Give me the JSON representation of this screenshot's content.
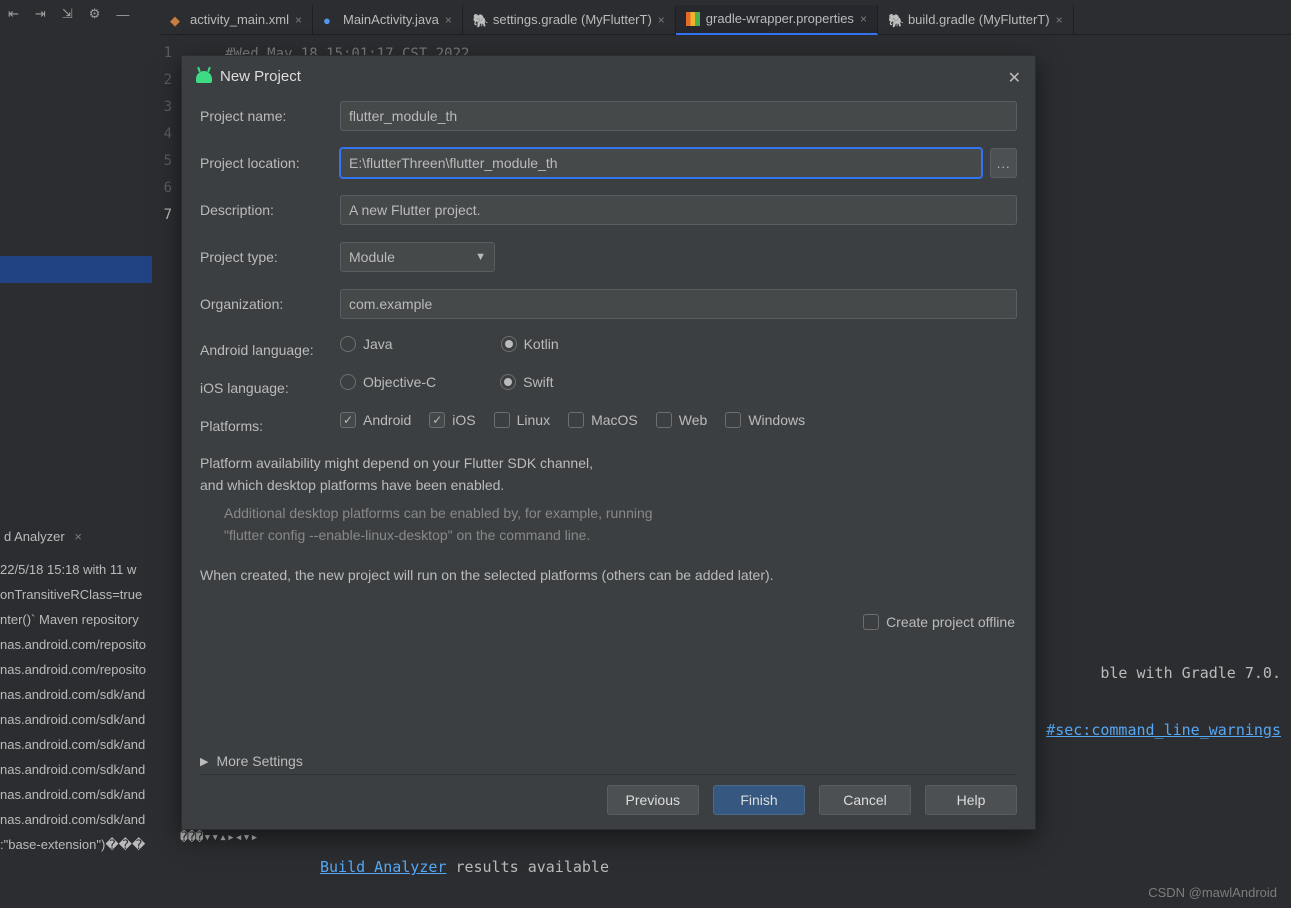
{
  "toolbar_icons": [
    "⇤",
    "⇥",
    "⇲",
    "⚙",
    "—"
  ],
  "tabs": [
    {
      "label": "activity_main.xml",
      "icon": "xml"
    },
    {
      "label": "MainActivity.java",
      "icon": "java"
    },
    {
      "label": "settings.gradle (MyFlutterT)",
      "icon": "gradle"
    },
    {
      "label": "gradle-wrapper.properties",
      "icon": "prop",
      "active": true
    },
    {
      "label": "build.gradle (MyFlutterT)",
      "icon": "gradle"
    }
  ],
  "gutter": [
    "1",
    "2",
    "3",
    "4",
    "5",
    "6",
    "7"
  ],
  "gutter_current": "7",
  "code_fragment": "#Wed May 18 15:01:17 CST 2022",
  "bottom": {
    "title": "d Analyzer",
    "lines": [
      "22/5/18 15:18 with 11 w",
      "onTransitiveRClass=true",
      "nter()` Maven repository",
      "nas.android.com/reposito",
      "nas.android.com/reposito",
      "nas.android.com/sdk/and",
      "nas.android.com/sdk/and",
      "nas.android.com/sdk/and",
      "nas.android.com/sdk/and",
      "nas.android.com/sdk/and",
      "nas.android.com/sdk/and",
      ":\"base-extension\")���"
    ]
  },
  "editor_out": {
    "line1": "ble with Gradle 7.0.",
    "link": "#sec:command_line_warnings",
    "build_link": "Build Analyzer",
    "build_rest": " results available"
  },
  "dialog": {
    "title": "New Project",
    "labels": {
      "name": "Project name:",
      "location": "Project location:",
      "desc": "Description:",
      "type": "Project type:",
      "org": "Organization:",
      "android_lang": "Android language:",
      "ios_lang": "iOS language:",
      "platforms": "Platforms:"
    },
    "values": {
      "name": "flutter_module_th",
      "location": "E:\\flutterThreen\\flutter_module_th",
      "desc": "A new Flutter project.",
      "type": "Module",
      "org": "com.example"
    },
    "android_lang": {
      "java": "Java",
      "kotlin": "Kotlin",
      "selected": "kotlin"
    },
    "ios_lang": {
      "objc": "Objective-C",
      "swift": "Swift",
      "selected": "swift"
    },
    "platforms": [
      {
        "name": "Android",
        "checked": true
      },
      {
        "name": "iOS",
        "checked": true
      },
      {
        "name": "Linux",
        "checked": false
      },
      {
        "name": "MacOS",
        "checked": false
      },
      {
        "name": "Web",
        "checked": false
      },
      {
        "name": "Windows",
        "checked": false
      }
    ],
    "info1": "Platform availability might depend on your Flutter SDK channel,\nand which desktop platforms have been enabled.",
    "info2": "Additional desktop platforms can be enabled by, for example, running\n\"flutter config --enable-linux-desktop\" on the command line.",
    "info3": "When created, the new project will run on the selected platforms (others can be added later).",
    "offline": "Create project offline",
    "more": "More Settings",
    "buttons": {
      "prev": "Previous",
      "finish": "Finish",
      "cancel": "Cancel",
      "help": "Help"
    }
  },
  "watermark": "CSDN @mawlAndroid"
}
